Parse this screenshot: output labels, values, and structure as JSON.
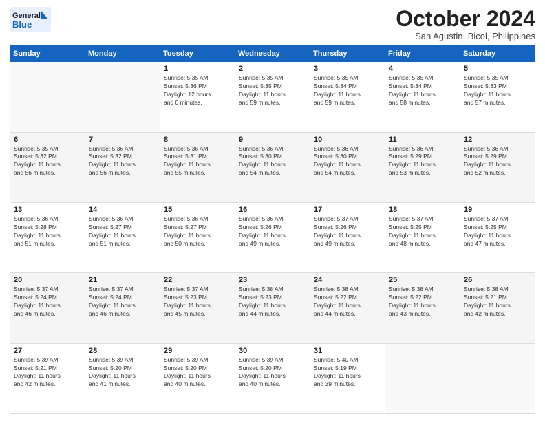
{
  "header": {
    "logo_line1": "General",
    "logo_line2": "Blue",
    "month": "October 2024",
    "location": "San Agustin, Bicol, Philippines"
  },
  "weekdays": [
    "Sunday",
    "Monday",
    "Tuesday",
    "Wednesday",
    "Thursday",
    "Friday",
    "Saturday"
  ],
  "weeks": [
    [
      {
        "day": "",
        "info": ""
      },
      {
        "day": "",
        "info": ""
      },
      {
        "day": "1",
        "info": "Sunrise: 5:35 AM\nSunset: 5:36 PM\nDaylight: 12 hours\nand 0 minutes."
      },
      {
        "day": "2",
        "info": "Sunrise: 5:35 AM\nSunset: 5:35 PM\nDaylight: 11 hours\nand 59 minutes."
      },
      {
        "day": "3",
        "info": "Sunrise: 5:35 AM\nSunset: 5:34 PM\nDaylight: 11 hours\nand 59 minutes."
      },
      {
        "day": "4",
        "info": "Sunrise: 5:35 AM\nSunset: 5:34 PM\nDaylight: 11 hours\nand 58 minutes."
      },
      {
        "day": "5",
        "info": "Sunrise: 5:35 AM\nSunset: 5:33 PM\nDaylight: 11 hours\nand 57 minutes."
      }
    ],
    [
      {
        "day": "6",
        "info": "Sunrise: 5:35 AM\nSunset: 5:32 PM\nDaylight: 11 hours\nand 56 minutes."
      },
      {
        "day": "7",
        "info": "Sunrise: 5:36 AM\nSunset: 5:32 PM\nDaylight: 11 hours\nand 56 minutes."
      },
      {
        "day": "8",
        "info": "Sunrise: 5:36 AM\nSunset: 5:31 PM\nDaylight: 11 hours\nand 55 minutes."
      },
      {
        "day": "9",
        "info": "Sunrise: 5:36 AM\nSunset: 5:30 PM\nDaylight: 11 hours\nand 54 minutes."
      },
      {
        "day": "10",
        "info": "Sunrise: 5:36 AM\nSunset: 5:30 PM\nDaylight: 11 hours\nand 54 minutes."
      },
      {
        "day": "11",
        "info": "Sunrise: 5:36 AM\nSunset: 5:29 PM\nDaylight: 11 hours\nand 53 minutes."
      },
      {
        "day": "12",
        "info": "Sunrise: 5:36 AM\nSunset: 5:29 PM\nDaylight: 11 hours\nand 52 minutes."
      }
    ],
    [
      {
        "day": "13",
        "info": "Sunrise: 5:36 AM\nSunset: 5:28 PM\nDaylight: 11 hours\nand 51 minutes."
      },
      {
        "day": "14",
        "info": "Sunrise: 5:36 AM\nSunset: 5:27 PM\nDaylight: 11 hours\nand 51 minutes."
      },
      {
        "day": "15",
        "info": "Sunrise: 5:36 AM\nSunset: 5:27 PM\nDaylight: 11 hours\nand 50 minutes."
      },
      {
        "day": "16",
        "info": "Sunrise: 5:36 AM\nSunset: 5:26 PM\nDaylight: 11 hours\nand 49 minutes."
      },
      {
        "day": "17",
        "info": "Sunrise: 5:37 AM\nSunset: 5:26 PM\nDaylight: 11 hours\nand 49 minutes."
      },
      {
        "day": "18",
        "info": "Sunrise: 5:37 AM\nSunset: 5:25 PM\nDaylight: 11 hours\nand 48 minutes."
      },
      {
        "day": "19",
        "info": "Sunrise: 5:37 AM\nSunset: 5:25 PM\nDaylight: 11 hours\nand 47 minutes."
      }
    ],
    [
      {
        "day": "20",
        "info": "Sunrise: 5:37 AM\nSunset: 5:24 PM\nDaylight: 11 hours\nand 46 minutes."
      },
      {
        "day": "21",
        "info": "Sunrise: 5:37 AM\nSunset: 5:24 PM\nDaylight: 11 hours\nand 46 minutes."
      },
      {
        "day": "22",
        "info": "Sunrise: 5:37 AM\nSunset: 5:23 PM\nDaylight: 11 hours\nand 45 minutes."
      },
      {
        "day": "23",
        "info": "Sunrise: 5:38 AM\nSunset: 5:23 PM\nDaylight: 11 hours\nand 44 minutes."
      },
      {
        "day": "24",
        "info": "Sunrise: 5:38 AM\nSunset: 5:22 PM\nDaylight: 11 hours\nand 44 minutes."
      },
      {
        "day": "25",
        "info": "Sunrise: 5:38 AM\nSunset: 5:22 PM\nDaylight: 11 hours\nand 43 minutes."
      },
      {
        "day": "26",
        "info": "Sunrise: 5:38 AM\nSunset: 5:21 PM\nDaylight: 11 hours\nand 42 minutes."
      }
    ],
    [
      {
        "day": "27",
        "info": "Sunrise: 5:39 AM\nSunset: 5:21 PM\nDaylight: 11 hours\nand 42 minutes."
      },
      {
        "day": "28",
        "info": "Sunrise: 5:39 AM\nSunset: 5:20 PM\nDaylight: 11 hours\nand 41 minutes."
      },
      {
        "day": "29",
        "info": "Sunrise: 5:39 AM\nSunset: 5:20 PM\nDaylight: 11 hours\nand 40 minutes."
      },
      {
        "day": "30",
        "info": "Sunrise: 5:39 AM\nSunset: 5:20 PM\nDaylight: 11 hours\nand 40 minutes."
      },
      {
        "day": "31",
        "info": "Sunrise: 5:40 AM\nSunset: 5:19 PM\nDaylight: 11 hours\nand 39 minutes."
      },
      {
        "day": "",
        "info": ""
      },
      {
        "day": "",
        "info": ""
      }
    ]
  ]
}
